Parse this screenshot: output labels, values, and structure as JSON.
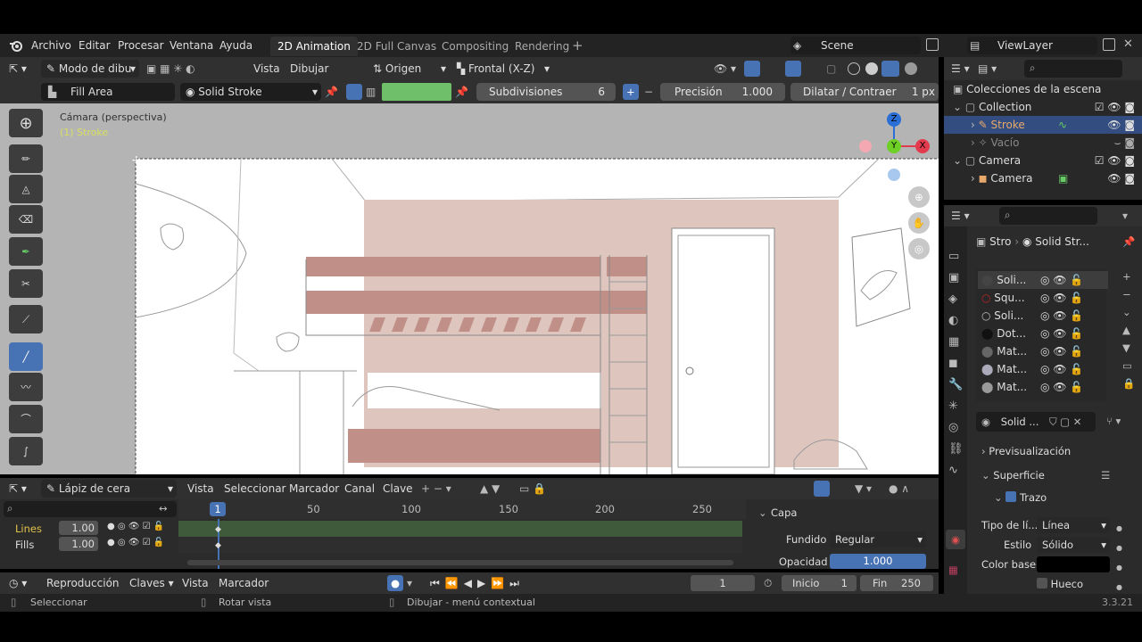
{
  "menu": {
    "archivo": "Archivo",
    "editar": "Editar",
    "procesar": "Procesar",
    "ventana": "Ventana",
    "ayuda": "Ayuda"
  },
  "workspaces": [
    "2D Animation",
    "2D Full Canvas",
    "Compositing",
    "Rendering"
  ],
  "scene": "Scene",
  "viewlayer": "ViewLayer",
  "header": {
    "mode": "Modo de dibu",
    "vista": "Vista",
    "dibujar": "Dibujar",
    "origen": "Origen",
    "frontal": "Frontal (X-Z)"
  },
  "toolsettings": {
    "fill": "Fill Area",
    "material": "Solid Stroke",
    "subdiv_label": "Subdivisiones",
    "subdiv_value": "6",
    "prec_label": "Precisión",
    "prec_value": "1.000",
    "dilate_label": "Dilatar / Contraer",
    "dilate_value": "1 px",
    "fill_color": "#6fbf6a"
  },
  "viewport": {
    "camera_label": "Cámara (perspectiva)",
    "object_label": "(1) Stroke"
  },
  "gizmo": {
    "x": "X",
    "y": "Y",
    "z": "Z"
  },
  "outliner": {
    "title": "Colecciones de la escena",
    "items": [
      "Collection",
      "Stroke",
      "Vacío",
      "Camera",
      "Camera"
    ]
  },
  "props": {
    "breadcrumb1": "Stro",
    "breadcrumb2": "Solid Str...",
    "materials": [
      "Soli...",
      "Squ...",
      "Soli...",
      "Dot...",
      "Mat...",
      "Mat...",
      "Mat..."
    ],
    "matfield": "Solid ...",
    "preview": "Previsualización",
    "surface": "Superficie",
    "stroke": "Trazo",
    "line_type_label": "Tipo de lí...",
    "line_type": "Línea",
    "style_label": "Estilo",
    "style": "Sólido",
    "base_color_label": "Color base",
    "hollow": "Hueco"
  },
  "timeline": {
    "mode": "Lápiz de cera",
    "menus": [
      "Vista",
      "Seleccionar",
      "Marcador",
      "Canal",
      "Clave"
    ],
    "frames": [
      "1",
      "50",
      "100",
      "150",
      "200",
      "250"
    ],
    "layers": [
      {
        "name": "Lines",
        "value": "1.00"
      },
      {
        "name": "Fills",
        "value": "1.00"
      }
    ]
  },
  "capa": {
    "title": "Capa",
    "blend_label": "Fundido",
    "blend": "Regular",
    "opacity_label": "Opacidad",
    "opacity": "1.000"
  },
  "playback": {
    "reproduccion": "Reproducción",
    "claves": "Claves",
    "vista": "Vista",
    "marcador": "Marcador",
    "frame": "1",
    "inicio_label": "Inicio",
    "inicio": "1",
    "fin_label": "Fin",
    "fin": "250"
  },
  "status": {
    "select": "Seleccionar",
    "rotate": "Rotar vista",
    "draw": "Dibujar - menú contextual",
    "version": "3.3.21"
  }
}
